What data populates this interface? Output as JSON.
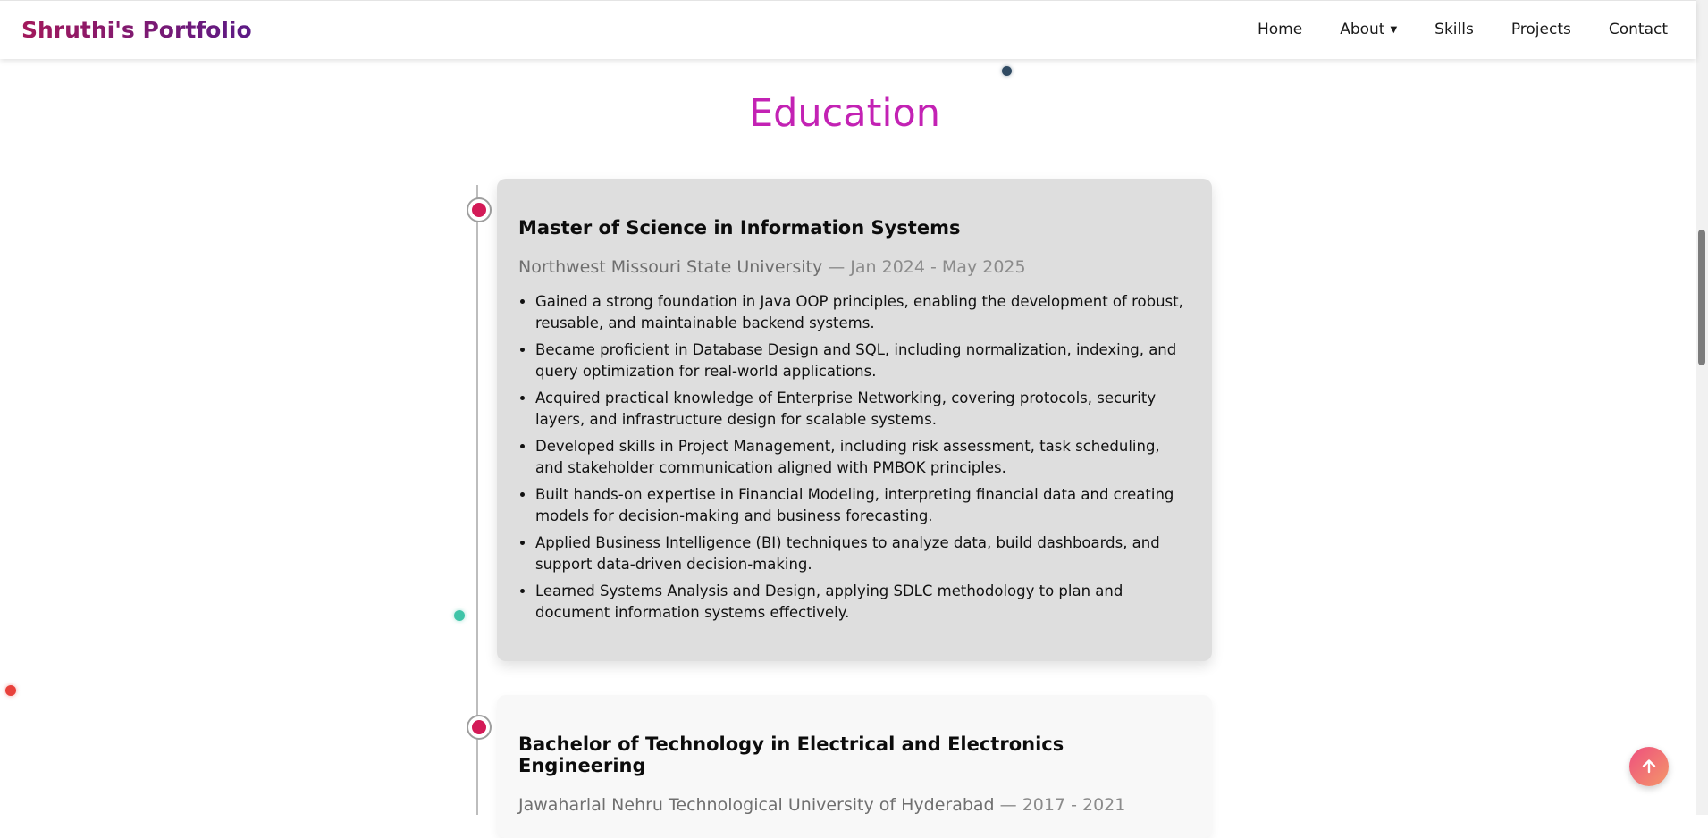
{
  "nav": {
    "brand": "Shruthi's Portfolio",
    "links": [
      "Home",
      "About",
      "Skills",
      "Projects",
      "Contact"
    ],
    "about_caret": "▼"
  },
  "section": {
    "title": "Education"
  },
  "education": [
    {
      "degree": "Master of Science in Information Systems",
      "school": "Northwest Missouri State University",
      "dates": "— Jan 2024 - May 2025",
      "bullets": [
        "Gained a strong foundation in Java OOP principles, enabling the development of robust, reusable, and maintainable backend systems.",
        "Became proficient in Database Design and SQL, including normalization, indexing, and query optimization for real-world applications.",
        "Acquired practical knowledge of Enterprise Networking, covering protocols, security layers, and infrastructure design for scalable systems.",
        "Developed skills in Project Management, including risk assessment, task scheduling, and stakeholder communication aligned with PMBOK principles.",
        "Built hands-on expertise in Financial Modeling, interpreting financial data and creating models for decision-making and business forecasting.",
        "Applied Business Intelligence (BI) techniques to analyze data, build dashboards, and support data-driven decision-making.",
        "Learned Systems Analysis and Design, applying SDLC methodology to plan and document information systems effectively."
      ]
    },
    {
      "degree": "Bachelor of Technology in Electrical and Electronics Engineering",
      "school": "Jawaharlal Nehru Technological University of Hyderabad",
      "dates": "— 2017 - 2021"
    }
  ],
  "colors": {
    "title": "#c322b4",
    "timeline_dot": "#d31a57",
    "card_active": "#dedede",
    "scroll_button_start": "#ee4f7e",
    "scroll_button_end": "#f4976a"
  },
  "icons": {
    "scroll_top": "arrow-up-icon"
  }
}
